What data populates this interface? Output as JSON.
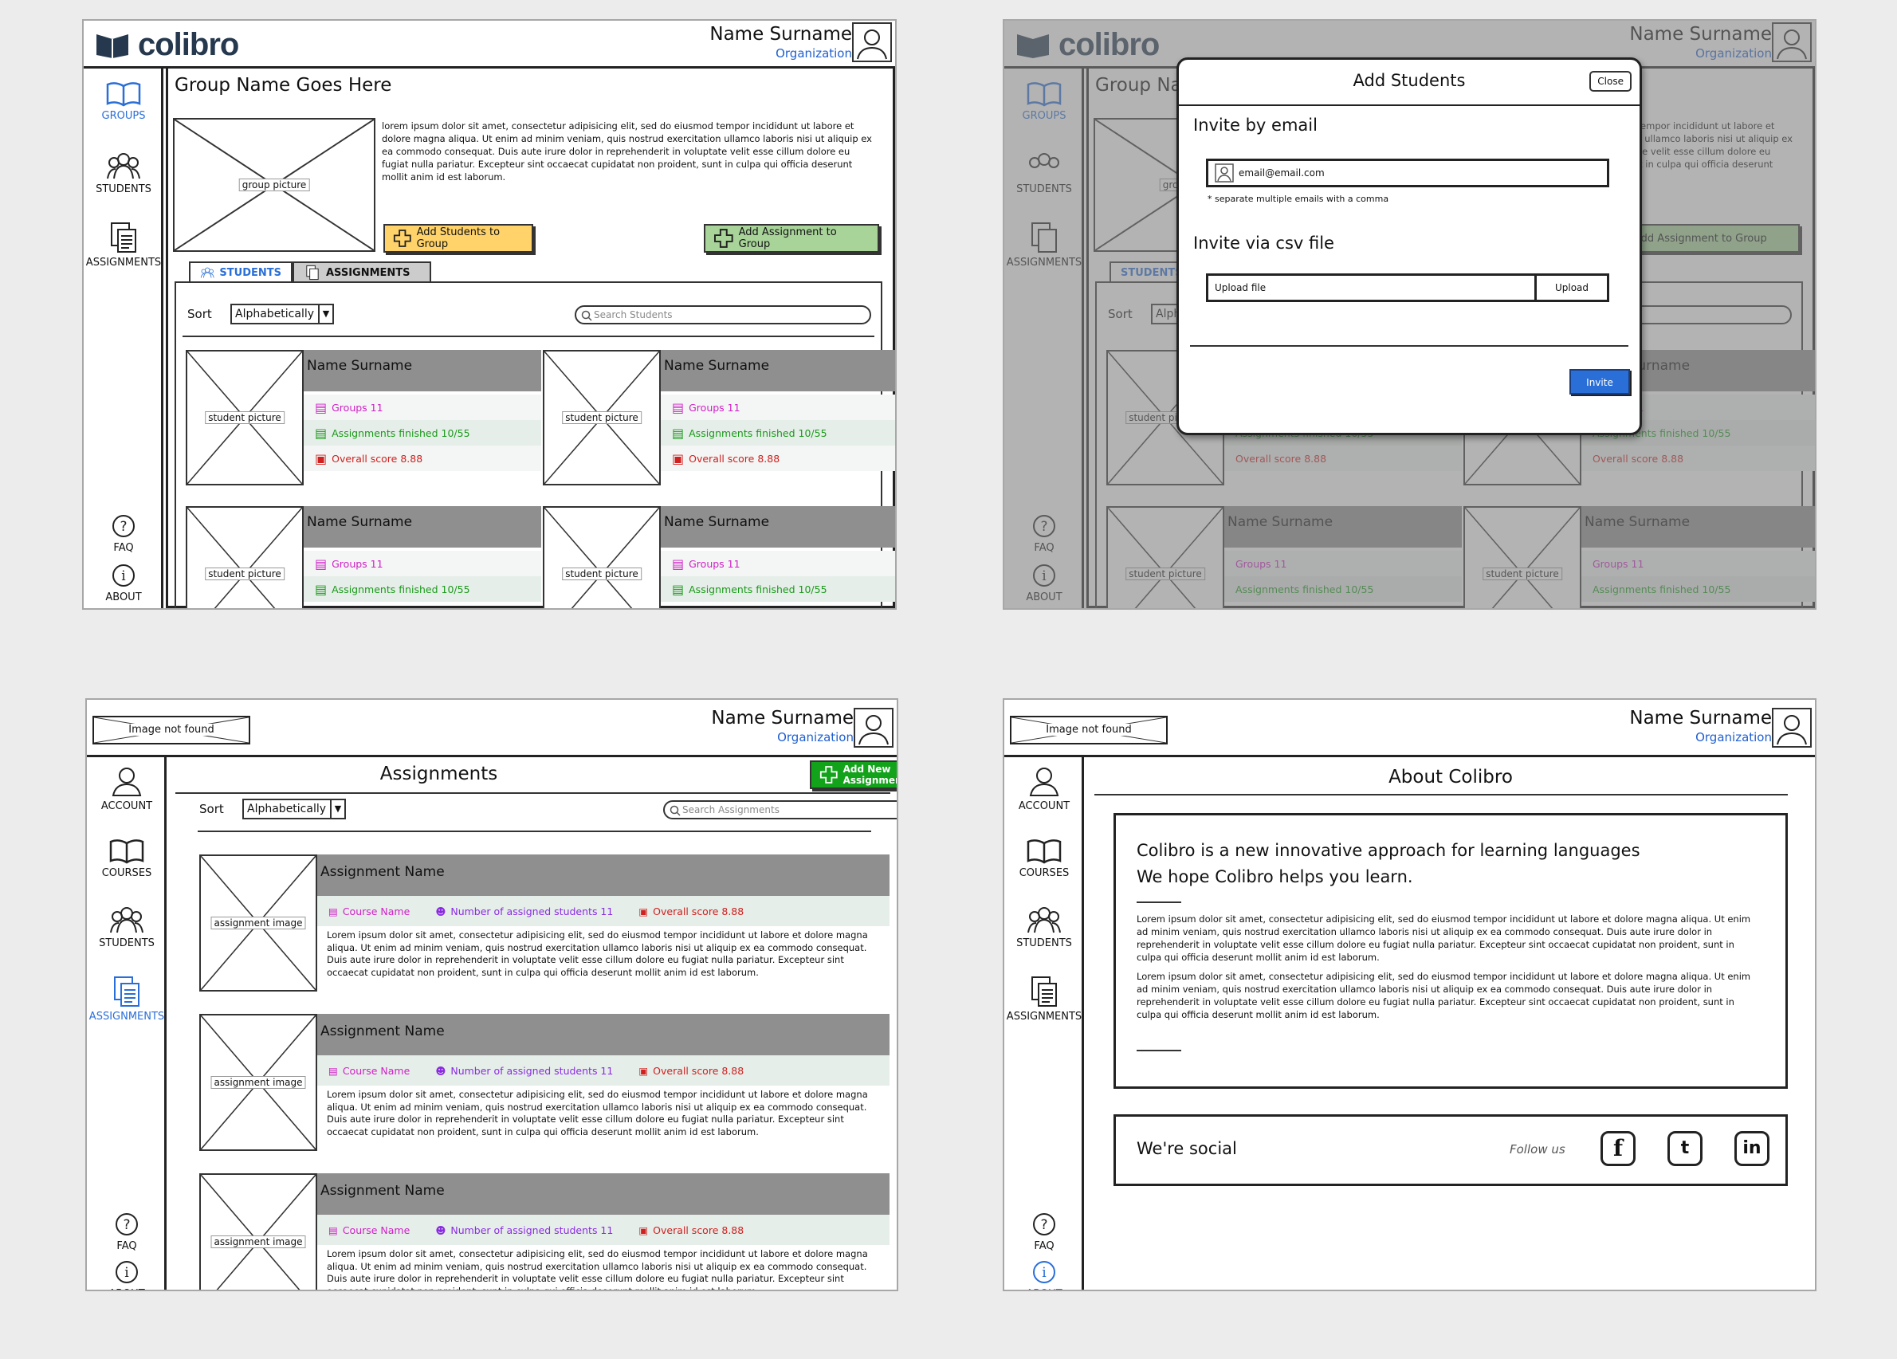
{
  "brand": {
    "logo_text": "colibro",
    "color": "#25384e",
    "image_not_found": "Image not found"
  },
  "user": {
    "name": "Name Surname",
    "org": "Organization"
  },
  "nav": {
    "groups": "GROUPS",
    "students": "STUDENTS",
    "assignments": "ASSIGNMENTS",
    "faq": "FAQ",
    "about": "ABOUT",
    "account": "ACCOUNT",
    "courses": "COURSES"
  },
  "group": {
    "title": "Group Name Goes Here",
    "picture": "group picture",
    "description": "lorem ipsum dolor sit amet, consectetur adipisicing elit, sed do eiusmod tempor incididunt ut labore et dolore magna aliqua. Ut enim ad minim veniam, quis nostrud exercitation ullamco laboris nisi ut aliquip ex ea commodo consequat. Duis aute irure dolor in reprehenderit in voluptate velit esse cillum dolore eu fugiat nulla pariatur. Excepteur sint occaecat cupidatat non proident, sunt in culpa qui officia deserunt mollit anim id est laborum.",
    "add_students": "Add Students to Group",
    "add_assignment": "Add Assignment to Group",
    "tab_students": "STUDENTS",
    "tab_assignments": "ASSIGNMENTS",
    "sort_label": "Sort",
    "sort_value": "Alphabetically",
    "search_placeholder": "Search Students",
    "student": {
      "name": "Name Surname",
      "picture": "student picture",
      "groups": "Groups 11",
      "assignments": "Assignments finished 10/55",
      "score": "Overall score 8.88"
    }
  },
  "modal": {
    "title": "Add Students",
    "close": "Close",
    "invite_email": "Invite by email",
    "email_placeholder": "email@email.com",
    "hint": "* separate multiple emails with a comma",
    "invite_csv": "Invite via csv file",
    "upload_placeholder": "Upload file",
    "upload_button": "Upload",
    "invite_button": "Invite"
  },
  "assignments": {
    "title": "Assignments",
    "add_new": "Add New Assignment",
    "sort_label": "Sort",
    "sort_value": "Alphabetically",
    "search_placeholder": "Search Assignments",
    "item": {
      "name": "Assignment Name",
      "image": "assignment image",
      "course": "Course Name",
      "students": "Number of assigned students 11",
      "score": "Overall score 8.88",
      "text": "Lorem ipsum dolor sit amet, consectetur adipisicing elit, sed do eiusmod tempor incididunt ut labore et dolore magna aliqua. Ut enim ad minim veniam, quis nostrud exercitation ullamco laboris nisi ut aliquip ex ea commodo consequat. Duis aute irure dolor in reprehenderit in voluptate velit esse cillum dolore eu fugiat nulla pariatur. Excepteur sint occaecat cupidatat non proident, sunt in culpa qui officia deserunt mollit anim id est laborum."
    }
  },
  "about": {
    "title": "About Colibro",
    "line1": "Colibro is a new innovative approach for learning languages",
    "line2": "We hope Colibro helps you learn.",
    "para": "Lorem ipsum dolor sit amet, consectetur adipisicing elit, sed do eiusmod tempor incididunt ut labore et dolore magna aliqua. Ut enim ad minim veniam, quis nostrud exercitation ullamco laboris nisi ut aliquip ex ea commodo consequat. Duis aute irure dolor in reprehenderit in voluptate velit esse cillum dolore eu fugiat nulla pariatur. Excepteur sint occaecat cupidatat non proident, sunt in culpa qui officia deserunt mollit anim id est laborum.",
    "social_title": "We're social",
    "follow": "Follow us",
    "icons": [
      "facebook-icon",
      "twitter-icon",
      "linkedin-icon"
    ]
  },
  "colors": {
    "accent_blue": "#2a6fd8",
    "groups_magenta": "#d020c8",
    "assign_green": "#1a9a1a",
    "score_red": "#d02020",
    "students_purple": "#8a2be2",
    "add_yellow": "#ffd36a",
    "add_green": "#a8d49a",
    "new_assignment": "#12a31a",
    "header_gray": "#8f8f8f"
  }
}
